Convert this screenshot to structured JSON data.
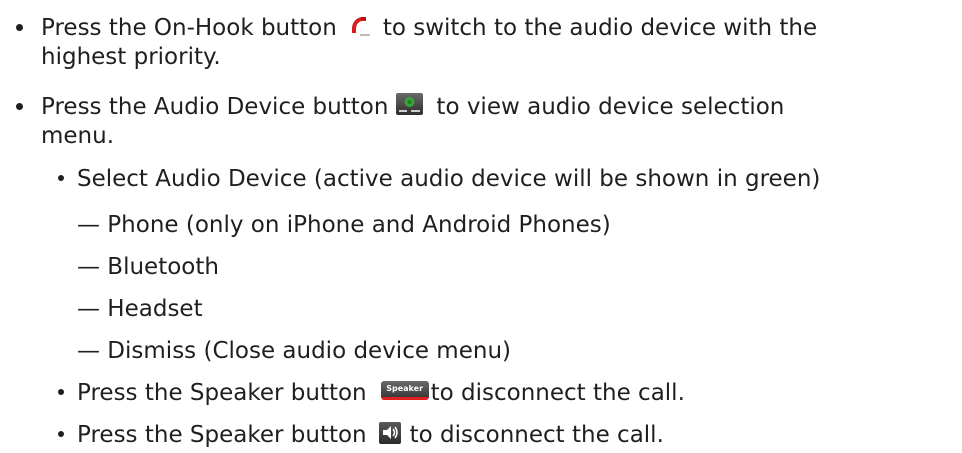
{
  "items": [
    {
      "before": "Press the On-Hook button",
      "icon": "on-hook-phone-icon",
      "after": "to switch to the audio device with the",
      "continuation": "highest priority."
    },
    {
      "before": "Press the Audio Device button",
      "icon": "audio-device-icon",
      "after": "to view audio device selection",
      "continuation": "menu."
    }
  ],
  "select_heading": "Select Audio Device (active audio device will be shown in green)",
  "devices": [
    "— Phone (only on iPhone and Android Phones)",
    "— Bluetooth",
    "— Headset",
    "— Dismiss (Close audio device menu)"
  ],
  "speaker_items": [
    {
      "before": "Press the Speaker button",
      "icon": "speaker-label-button-icon",
      "icon_label": "Speaker",
      "after": "to disconnect the call."
    },
    {
      "before": "Press the Speaker button",
      "icon": "speaker-volume-icon",
      "after": "to disconnect the call."
    }
  ],
  "colors": {
    "text": "#1f1f1f",
    "onhook_red": "#d81e1e",
    "audio_green": "#3aa33a",
    "speaker_red_bar": "#e02020"
  }
}
